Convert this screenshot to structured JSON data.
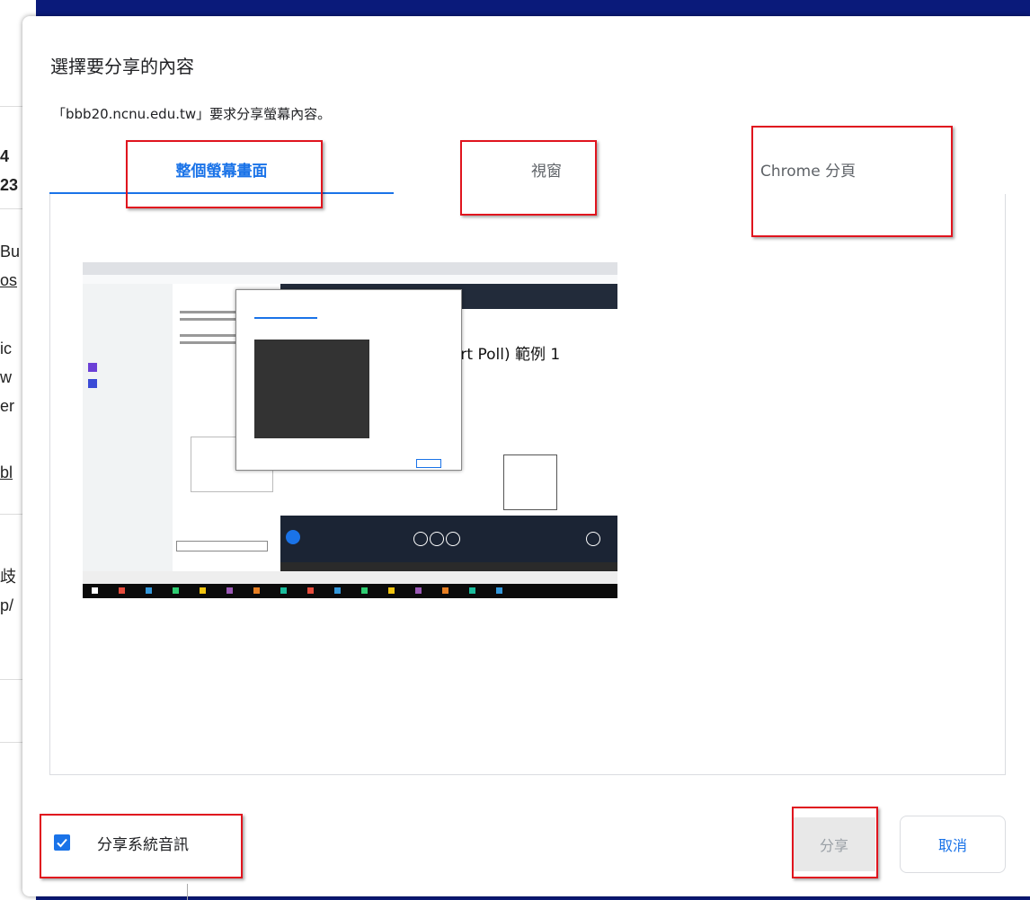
{
  "dialog": {
    "title": "選擇要分享的內容",
    "subtitle": "「bbb20.ncnu.edu.tw」要求分享螢幕內容。"
  },
  "tabs": [
    {
      "label": "整個螢幕畫面",
      "active": true
    },
    {
      "label": "視窗",
      "active": false
    },
    {
      "label": "Chrome 分頁",
      "active": false
    }
  ],
  "preview": {
    "slide_text": "art Poll) 範例 1"
  },
  "footer": {
    "audio_label": "分享系統音訊",
    "audio_checked": true,
    "share_label": "分享",
    "cancel_label": "取消"
  },
  "background_fragments": [
    "4",
    "23",
    "Bu",
    "os",
    "ic",
    "w",
    "er",
    "bl",
    "歧",
    "p/"
  ],
  "colors": {
    "accent": "#1a73e8",
    "annotation_red": "#e0141e",
    "backdrop": "#0a1a7a"
  }
}
